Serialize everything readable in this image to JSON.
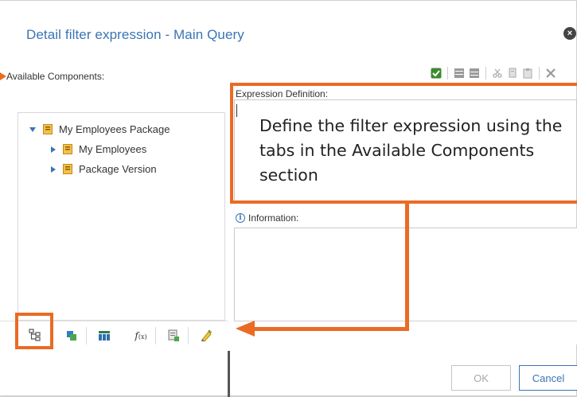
{
  "dialog": {
    "title": "Detail filter expression - Main Query",
    "close_symbol": "×"
  },
  "left_panel": {
    "label": "Available Components:",
    "tree": [
      {
        "label": "My Employees Package",
        "expanded": true,
        "icon": "package-icon"
      },
      {
        "label": "My Employees",
        "expanded": false,
        "icon": "package-icon"
      },
      {
        "label": "Package Version",
        "expanded": false,
        "icon": "package-icon"
      }
    ],
    "tabs": [
      {
        "icon": "source-tree-icon",
        "active": true
      },
      {
        "icon": "data-items-icon",
        "active": false
      },
      {
        "icon": "query-items-icon",
        "active": false
      },
      {
        "icon": "functions-icon",
        "label": "f",
        "sub": "(x)",
        "active": false
      },
      {
        "icon": "parameters-icon",
        "active": false
      },
      {
        "icon": "history-icon",
        "active": false
      }
    ]
  },
  "toolbar": {
    "items": [
      "validate-icon",
      "insert-before-icon",
      "insert-after-icon",
      "cut-icon",
      "copy-icon",
      "paste-icon",
      "delete-icon"
    ]
  },
  "expression": {
    "label": "Expression Definition:",
    "value": ""
  },
  "information": {
    "label": "Information:",
    "icon_glyph": "i"
  },
  "buttons": {
    "ok": "OK",
    "cancel": "Cancel"
  },
  "annotation": {
    "callout_text": "Define the filter expression using the tabs in the Available Components section"
  },
  "colors": {
    "accent": "#3a74b5",
    "annotation": "#ea6b24",
    "validate_green": "#3d8a2f"
  }
}
